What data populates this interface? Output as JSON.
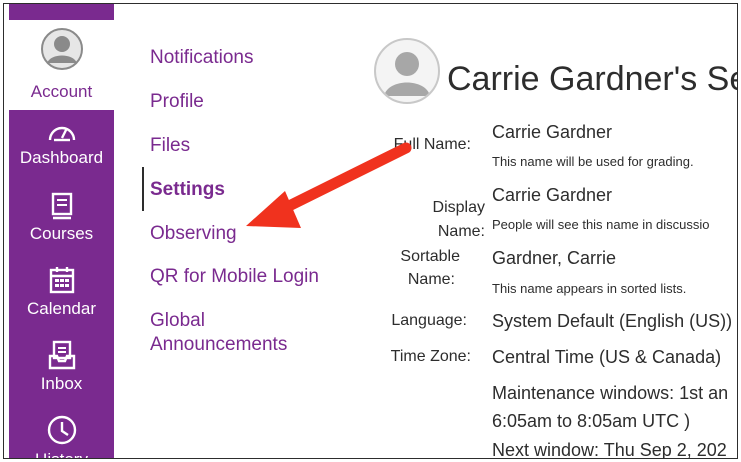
{
  "colors": {
    "brand": "#7a2a8f",
    "arrow": "#f0321e",
    "text": "#2d2d2d"
  },
  "global_nav": {
    "account_label": "Account",
    "items": [
      {
        "label": "Dashboard",
        "icon": "dashboard-icon"
      },
      {
        "label": "Courses",
        "icon": "courses-icon"
      },
      {
        "label": "Calendar",
        "icon": "calendar-icon"
      },
      {
        "label": "Inbox",
        "icon": "inbox-icon"
      },
      {
        "label": "History",
        "icon": "history-icon"
      }
    ]
  },
  "sub_nav": {
    "items": [
      {
        "label": "Notifications"
      },
      {
        "label": "Profile"
      },
      {
        "label": "Files"
      },
      {
        "label": "Settings"
      },
      {
        "label": "Observing"
      },
      {
        "label": "QR for Mobile Login"
      },
      {
        "label": "Global"
      },
      {
        "label": "Announcements"
      }
    ],
    "active": "Settings"
  },
  "settings": {
    "title": "Carrie Gardner's Se",
    "full_name_label": "Full Name:",
    "full_name_value": "Carrie Gardner",
    "full_name_hint": "This name will be used for grading.",
    "display_name_label": "Display Name:",
    "display_name_value": "Carrie Gardner",
    "display_name_hint": "People will see this name in discussio",
    "sortable_name_label_1": "Sortable",
    "sortable_name_label_2": "Name:",
    "sortable_name_value": "Gardner, Carrie",
    "sortable_name_hint": "This name appears in sorted lists.",
    "language_label": "Language:",
    "language_value": "System Default (English (US))",
    "timezone_label": "Time Zone:",
    "timezone_value": "Central Time (US & Canada)",
    "maintenance_line_1": "Maintenance windows: 1st an",
    "maintenance_line_2": "6:05am to 8:05am UTC )",
    "maintenance_line_3": "Next window: Thu Sep 2, 202"
  }
}
